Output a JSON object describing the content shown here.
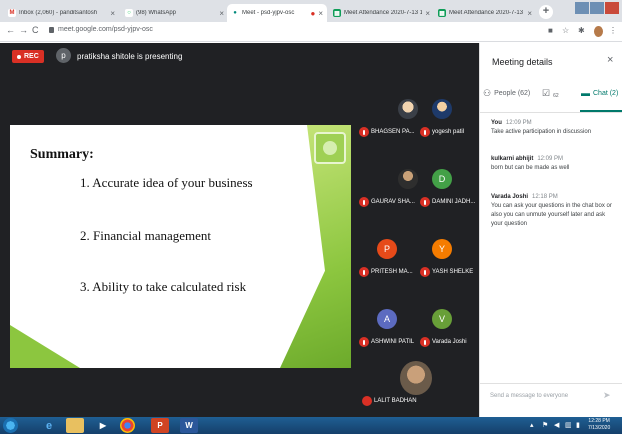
{
  "browser": {
    "tabs": [
      {
        "label": "Inbox (2,060) - panditsantosh",
        "favicon": "gmail-icon",
        "color": "#d93025",
        "glyph": "M"
      },
      {
        "label": "(98) WhatsApp",
        "favicon": "whatsapp-icon",
        "color": "#25d366",
        "glyph": "○"
      },
      {
        "label": "Meet - psd-yjpv-osc",
        "favicon": "meet-icon",
        "color": "#00897b",
        "glyph": "●"
      },
      {
        "label": "Meet Attendance 2020-7-13 1",
        "favicon": "sheets-icon",
        "color": "#0f9d58",
        "glyph": "▦"
      },
      {
        "label": "Meet Attendance 2020-7-13 1",
        "favicon": "sheets-icon",
        "color": "#0f9d58",
        "glyph": "▦"
      }
    ],
    "url": "meet.google.com/psd-yjpv-osc"
  },
  "meet": {
    "rec_label": "REC",
    "presenter_initial": "p",
    "presenter_text": "pratiksha shitole is presenting",
    "slide": {
      "title": "Summary:",
      "points": [
        "1. Accurate idea of your business",
        "2. Financial management",
        "3. Ability to take calculated risk"
      ]
    },
    "participants": [
      {
        "name": "BHAGSEN PA...",
        "initial": "",
        "color": "photo"
      },
      {
        "name": "yogesh patil",
        "initial": "",
        "color": "photo2"
      },
      {
        "name": "GAURAV SHA...",
        "initial": "",
        "color": "photo3"
      },
      {
        "name": "DAMINI JADH...",
        "initial": "D",
        "color": "#43a047"
      },
      {
        "name": "PRITESH MA...",
        "initial": "P",
        "color": "#e64a19"
      },
      {
        "name": "YASH SHELKE",
        "initial": "Y",
        "color": "#f57c00"
      },
      {
        "name": "ASHWINI PATIL",
        "initial": "A",
        "color": "#5c6bc0"
      },
      {
        "name": "Varada Joshi",
        "initial": "V",
        "color": "#689f38"
      }
    ],
    "self_tile": {
      "name": "LALIT BADHAN"
    }
  },
  "panel": {
    "title": "Meeting details",
    "tabs": [
      {
        "label": "People (62)"
      },
      {
        "label": "62"
      },
      {
        "label": "Chat (2)"
      }
    ],
    "messages": [
      {
        "sender": "You",
        "time": "12:09 PM",
        "body": "Take active participation in discussion"
      },
      {
        "sender": "kulkarni abhijit",
        "time": "12:09 PM",
        "body": "born but can be made as well"
      },
      {
        "sender": "Varada Joshi",
        "time": "12:18 PM",
        "body": "You can ask your questions in the chat box or also you can unmute yourself later and ask your question"
      }
    ],
    "input_placeholder": "Send a message to everyone"
  },
  "taskbar": {
    "time": "12:28 PM",
    "date": "7/13/2020"
  }
}
